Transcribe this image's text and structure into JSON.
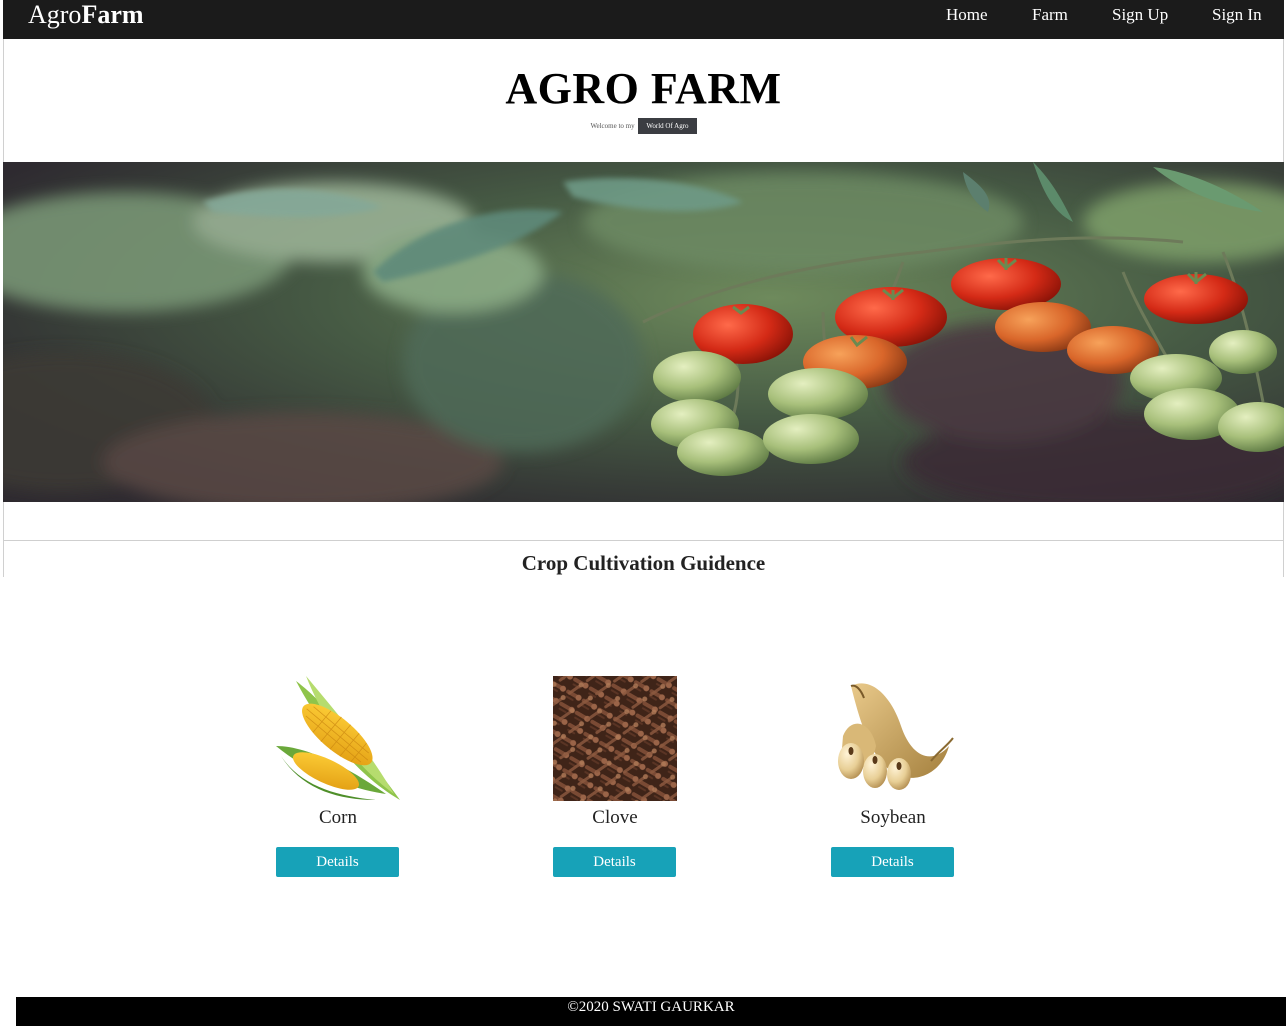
{
  "navbar": {
    "brand_light": "Agro",
    "brand_bold": "Farm",
    "links": [
      "Home",
      "Farm",
      "Sign Up",
      "Sign In"
    ]
  },
  "header": {
    "title": "AGRO FARM",
    "tagline_prefix": "Welcome to my",
    "tagline_badge": "World Of Agro"
  },
  "banner": {
    "subject": "cherry tomato vine"
  },
  "section": {
    "title": "Crop Cultivation Guidence"
  },
  "crops": [
    {
      "name": "Corn",
      "button": "Details",
      "icon": "corn-image"
    },
    {
      "name": "Clove",
      "button": "Details",
      "icon": "clove-image"
    },
    {
      "name": "Soybean",
      "button": "Details",
      "icon": "soybean-image"
    }
  ],
  "footer": {
    "text": "©2020 SWATI GAURKAR"
  },
  "colors": {
    "navbar_bg": "#1b1b1b",
    "button_bg": "#17a2b8",
    "footer_bg": "#000000",
    "badge_bg": "#3b3d42"
  }
}
